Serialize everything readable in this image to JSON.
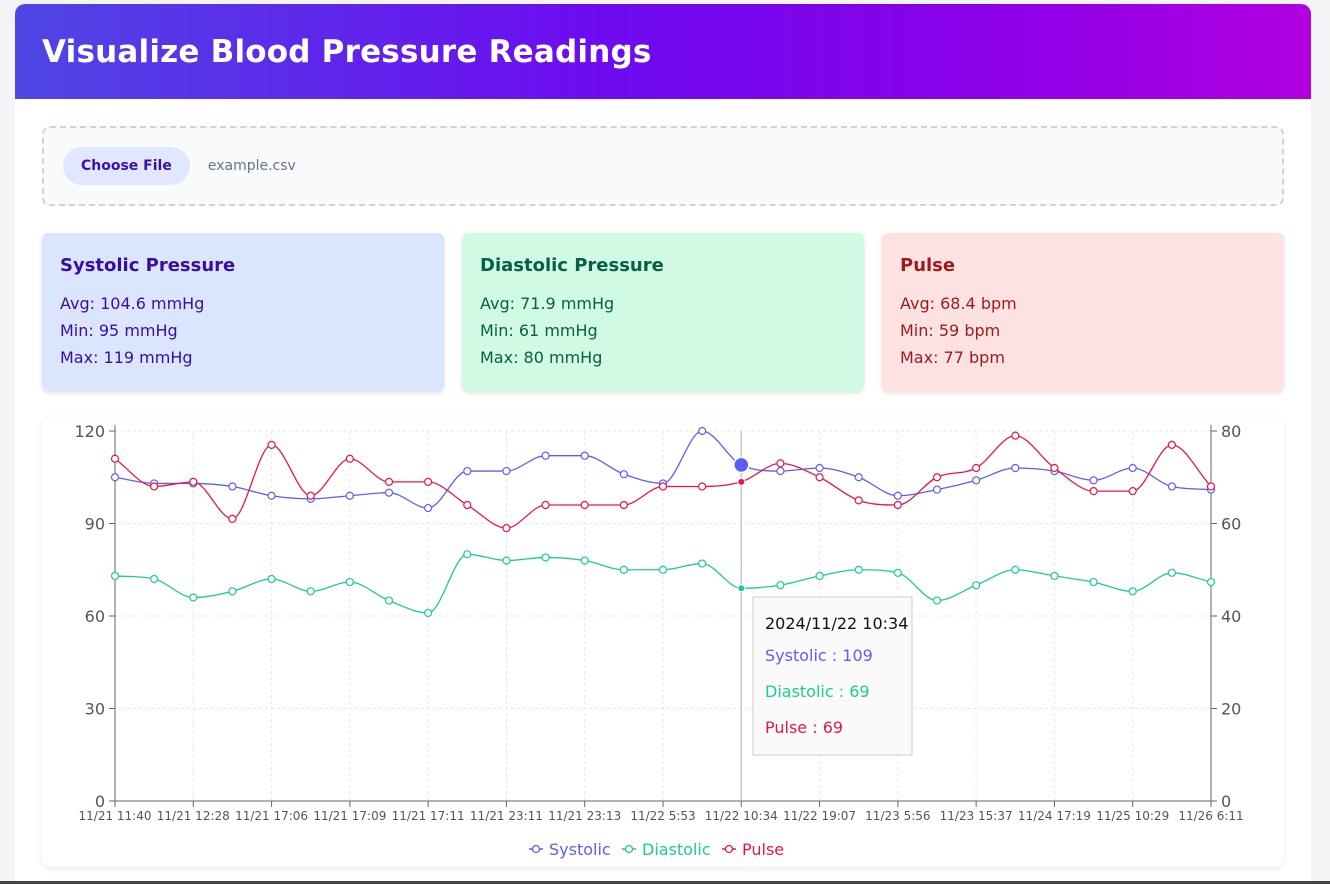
{
  "header": {
    "title": "Visualize Blood Pressure Readings"
  },
  "upload": {
    "button_label": "Choose File",
    "file_name": "example.csv"
  },
  "stats": [
    {
      "title": "Systolic Pressure",
      "avg": "Avg: 104.6 mmHg",
      "min": "Min: 95 mmHg",
      "max": "Max: 119 mmHg"
    },
    {
      "title": "Diastolic Pressure",
      "avg": "Avg: 71.9 mmHg",
      "min": "Min: 61 mmHg",
      "max": "Max: 80 mmHg"
    },
    {
      "title": "Pulse",
      "avg": "Avg: 68.4 bpm",
      "min": "Min: 59 bpm",
      "max": "Max: 77 bpm"
    }
  ],
  "colors": {
    "systolic": "#5b5ff0",
    "diastolic": "#1ecb8f",
    "pulse": "#e8174a"
  },
  "tooltip": {
    "title": "2024/11/22 10:34",
    "lines": [
      "Systolic : 109",
      "Diastolic : 69",
      "Pulse : 69"
    ]
  },
  "chart_data": {
    "type": "line",
    "x_tick_labels": [
      "11/21 11:40",
      "11/21 12:28",
      "11/21 17:06",
      "11/21 17:09",
      "11/21 17:11",
      "11/21 23:11",
      "11/21 23:13",
      "11/22 5:53",
      "11/22 10:34",
      "11/22 19:07",
      "11/23 5:56",
      "11/23 15:37",
      "11/24 17:19",
      "11/25 10:29",
      "11/26 6:11"
    ],
    "x_tick_index": [
      0,
      2,
      4,
      6,
      8,
      10,
      12,
      14,
      16,
      18,
      20,
      22,
      24,
      26,
      28
    ],
    "y_left": {
      "ticks": [
        0,
        30,
        60,
        90,
        120
      ],
      "ylim": [
        0,
        120
      ]
    },
    "y_right": {
      "ticks": [
        0,
        20,
        40,
        60,
        80
      ],
      "ylim": [
        0,
        80
      ]
    },
    "grid": true,
    "legend_position": "bottom",
    "highlight_index": 16,
    "series": [
      {
        "name": "Systolic",
        "axis": "left",
        "values": [
          105,
          103,
          103,
          102,
          99,
          98,
          99,
          100,
          95,
          107,
          107,
          112,
          112,
          106,
          103,
          120,
          109,
          107,
          108,
          105,
          99,
          101,
          104,
          108,
          107,
          104,
          108,
          102,
          101
        ]
      },
      {
        "name": "Diastolic",
        "axis": "left",
        "values": [
          73,
          72,
          66,
          68,
          72,
          68,
          71,
          65,
          61,
          80,
          78,
          79,
          78,
          75,
          75,
          77,
          69,
          70,
          73,
          75,
          74,
          65,
          70,
          75,
          73,
          71,
          68,
          74,
          71
        ]
      },
      {
        "name": "Pulse",
        "axis": "right",
        "values": [
          74,
          68,
          69,
          61,
          77,
          66,
          74,
          69,
          69,
          64,
          59,
          64,
          64,
          64,
          68,
          68,
          69,
          73,
          70,
          65,
          64,
          70,
          72,
          79,
          72,
          67,
          67,
          77,
          68
        ]
      }
    ]
  }
}
